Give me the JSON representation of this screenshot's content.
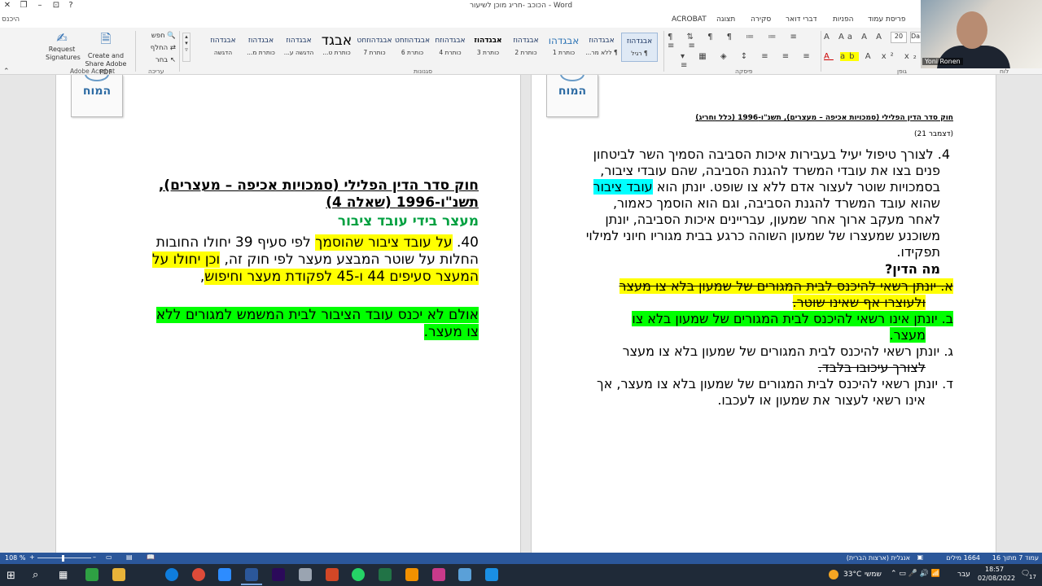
{
  "window": {
    "title": "הכוכב -חריג מוכן לשיעור - Word",
    "account": "היכנס"
  },
  "ribbon_tabs": [
    "פריסת עמוד",
    "הפניות",
    "דברי דואר",
    "סקירה",
    "תצוגה",
    "ACROBAT"
  ],
  "ribbon": {
    "acrobat": {
      "request": "Request Signatures",
      "create": "Create and Share Adobe PDF",
      "group": "Adobe Acrobat"
    },
    "editing": {
      "find": "חפש",
      "replace": "החלף",
      "select": "בחר",
      "group": "עריכה"
    },
    "styles_group": "סגנונות",
    "paragraph_group": "פיסקה",
    "font_group": "גופן",
    "clipboard_group": "לוח",
    "font_size": "20",
    "font_name": "Da",
    "styles": [
      {
        "sample": "אבגדהוז",
        "name": "¶ רגיל"
      },
      {
        "sample": "אבגדהוז",
        "name": "¶ ללא מר..."
      },
      {
        "sample": "אבגדהו",
        "name": "כותרת 1"
      },
      {
        "sample": "אבגדהוז",
        "name": "כותרת 2"
      },
      {
        "sample": "אבגדהוז",
        "name": "כותרת 3"
      },
      {
        "sample": "אבגדהוזח",
        "name": "כותרת 4"
      },
      {
        "sample": "אבגדהוזחט",
        "name": "כותרת 6"
      },
      {
        "sample": "אבגדהוזחט",
        "name": "כותרת 7"
      },
      {
        "sample": "אבגד",
        "name": "כותרת ט..."
      },
      {
        "sample": "אבגדהוז",
        "name": "הדגשה ע..."
      },
      {
        "sample": "אבגדהוז",
        "name": "כותרת מ..."
      },
      {
        "sample": "אבגדהוז",
        "name": "הדגשה"
      }
    ]
  },
  "webcam": {
    "name": "Yoni Ronen"
  },
  "logo_text": "המוח",
  "page_right": {
    "header_line": "חוק סדר הדין הפלילי (סמכויות אכיפה – מעצרים), תשנ\"ו-1996 (כלל וחריג)",
    "header_sub": "(דצמבר 21)",
    "paragraph_lines": [
      "4. לצורך טיפול  יעיל בעבירות איכות הסביבה הסמיך השר לביטחון",
      "פנים בצו את עובדי המשרד להגנת הסביבה, שהם עובדי ציבור,",
      "בסמכויות שוטר לעצור אדם ללא צו שופט. יונתן הוא",
      "שהוא עובד המשרד להגנת הסביבה, וגם הוא הוסמך כאמור,",
      "לאחר מעקב ארוך אחר שמעון, עבריינים איכות הסביבה, יונתן",
      "משוכנע שמעצרו של שמעון השוהה כרגע בבית מגוריו חיוני למילוי",
      "תפקידו."
    ],
    "highlight_public_servant": "עובד ציבור",
    "question": "מה הדין?",
    "answers": [
      "א. יונתן רשאי להיכנס לבית המגורים של שמעון בלא צו מעצר",
      "ולעוצרו אף שאינו שוטר.",
      "ב. יונתן אינו רשאי להיכנס לבית המגורים של שמעון בלא צו",
      "מעצר.",
      "ג. יונתן רשאי להיכנס לבית המגורים של שמעון בלא צו מעצר",
      "לצורך עיכובו בלבד.",
      "ד. יונתן רשאי להיכנס לבית המגורים של שמעון בלא צו מעצר, אך",
      "אינו רשאי לעצור את שמעון או לעכבו."
    ]
  },
  "page_left": {
    "title_line1": "חוק סדר הדין הפלילי (סמכויות אכיפה – מעצרים),",
    "title_line2": "תשנ\"ו-1996 (שאלה 4)",
    "subtitle": "מעצר בידי עובד ציבור",
    "p1_a": "40. ",
    "p1_hl": "על עובד ציבור שהוסמך",
    "p1_b": " לפי סעיף 39 יחולו החובות",
    "p1_line2_a": "החלות על שוטר המבצע מעצר לפי חוק זה, ",
    "p1_line2_hl": "וכן יחולו על",
    "p1_line3": "המעצר סעיפים 44 ו-45 לפקודת מעצר וחיפוש",
    "p1_line3_end": ",",
    "p2_line1": "אולם לא יכנס עובד הציבור לבית המשמש למגורים ללא",
    "p2_line2": "צו מעצר."
  },
  "status": {
    "page": "עמוד 7 מתוך 16",
    "words": "1664 מילים",
    "language": "אנגלית (ארצות הברית)",
    "zoom": "108 %"
  },
  "taskbar": {
    "temp": "33°C",
    "weather": "שמשי",
    "lang": "עבר",
    "time": "18:57",
    "date": "02/08/2022",
    "notif": "17"
  }
}
